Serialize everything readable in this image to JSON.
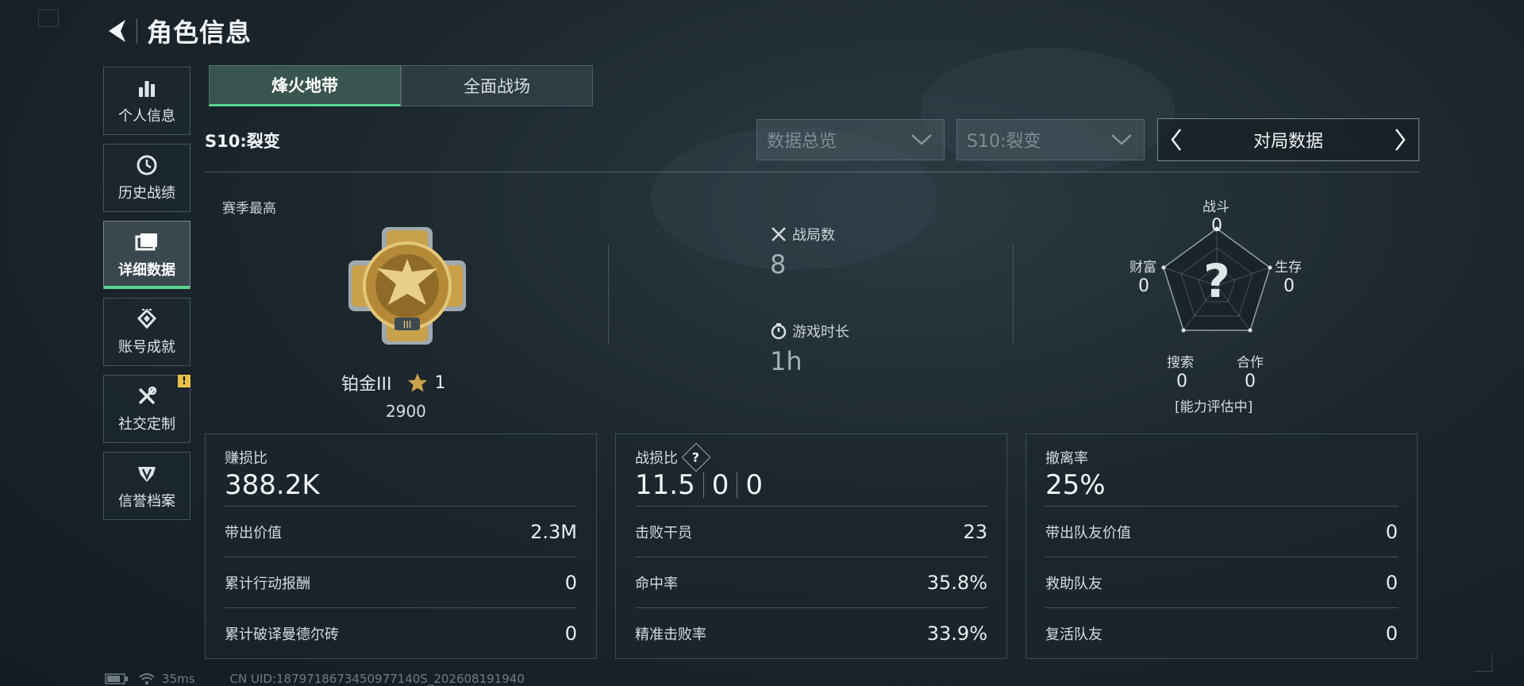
{
  "header": {
    "title": "角色信息",
    "back_icon": "back-arrow-icon"
  },
  "sidebar": {
    "items": [
      {
        "label": "个人信息",
        "icon": "bar-chart-icon",
        "active": false
      },
      {
        "label": "历史战绩",
        "icon": "clock-icon",
        "active": false
      },
      {
        "label": "详细数据",
        "icon": "folder-icon",
        "active": true
      },
      {
        "label": "账号成就",
        "icon": "achievement-icon",
        "active": false
      },
      {
        "label": "社交定制",
        "icon": "tools-icon",
        "active": false,
        "badge": "!"
      },
      {
        "label": "信誉档案",
        "icon": "shield-icon",
        "active": false
      }
    ]
  },
  "mode_tabs": [
    {
      "label": "烽火地带",
      "active": true
    },
    {
      "label": "全面战场",
      "active": false
    }
  ],
  "season_title": "S10:裂变",
  "filters": {
    "data_view": "数据总览",
    "season": "S10:裂变",
    "pager_label": "对局数据"
  },
  "summary": {
    "season_best_label": "赛季最高",
    "rank_name": "铂金III",
    "rank_stars": "1",
    "rank_score": "2900",
    "matches_label": "战局数",
    "matches_value": "8",
    "playtime_label": "游戏时长",
    "playtime_value": "1h"
  },
  "radar": {
    "center": "?",
    "status_note": "[能力评估中]",
    "axes": [
      {
        "label": "战斗",
        "value": "0"
      },
      {
        "label": "生存",
        "value": "0"
      },
      {
        "label": "合作",
        "value": "0"
      },
      {
        "label": "搜索",
        "value": "0"
      },
      {
        "label": "财富",
        "value": "0"
      }
    ]
  },
  "cards": [
    {
      "head_label": "赚损比",
      "head_values": [
        "388.2K"
      ],
      "rows": [
        {
          "label": "带出价值",
          "value": "2.3M"
        },
        {
          "label": "累计行动报酬",
          "value": "0"
        },
        {
          "label": "累计破译曼德尔砖",
          "value": "0"
        }
      ]
    },
    {
      "head_label": "战损比",
      "help": "?",
      "head_values": [
        "11.5",
        "0",
        "0"
      ],
      "rows": [
        {
          "label": "击败干员",
          "value": "23"
        },
        {
          "label": "命中率",
          "value": "35.8%"
        },
        {
          "label": "精准击败率",
          "value": "33.9%"
        }
      ]
    },
    {
      "head_label": "撤离率",
      "head_values": [
        "25%"
      ],
      "rows": [
        {
          "label": "带出队友价值",
          "value": "0"
        },
        {
          "label": "救助队友",
          "value": "0"
        },
        {
          "label": "复活队友",
          "value": "0"
        }
      ]
    }
  ],
  "status_bar": {
    "ping": "35ms",
    "uid": "CN UID:1879718673450977140S_202608191940"
  },
  "colors": {
    "accent": "#57d68d",
    "badge": "#e8c24a",
    "gold": "#c9a14a"
  }
}
